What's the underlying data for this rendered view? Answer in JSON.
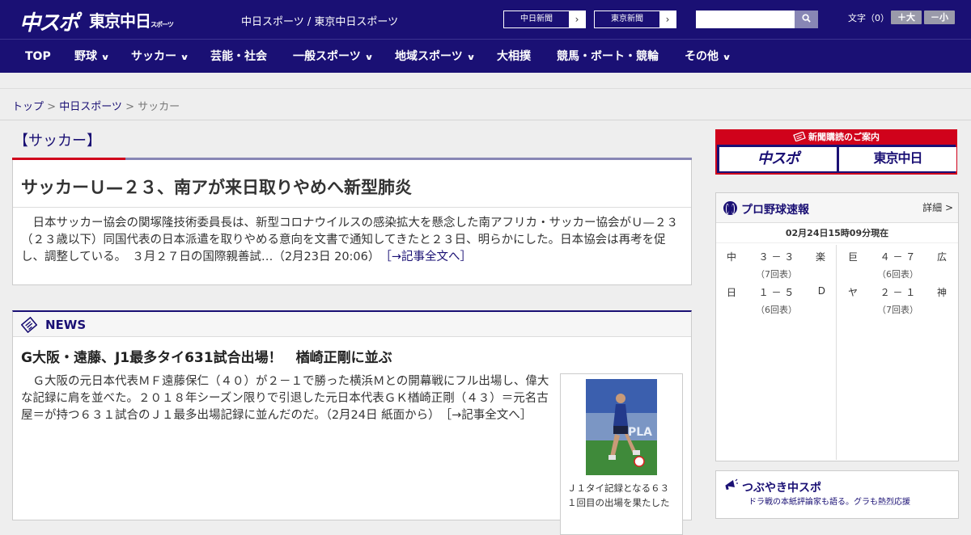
{
  "header": {
    "logo_chunichi": "中スポ",
    "logo_tokyo": "東京中日",
    "logo_tokyo_sub": "スポーツ",
    "site_title": "中日スポーツ / 東京中日スポーツ",
    "paper_links": [
      {
        "label": "中日新聞",
        "arrow": "›"
      },
      {
        "label": "東京新聞",
        "arrow": "›"
      }
    ],
    "search_value": "",
    "search_icon": "search-icon",
    "font_size_label": "文字（0）",
    "font_bigger": "＋大",
    "font_smaller": "－小"
  },
  "nav": [
    {
      "label": "TOP",
      "chevron": false
    },
    {
      "label": "野球",
      "chevron": true
    },
    {
      "label": "サッカー",
      "chevron": true
    },
    {
      "label": "芸能・社会",
      "chevron": false
    },
    {
      "label": "一般スポーツ",
      "chevron": true
    },
    {
      "label": "地域スポーツ",
      "chevron": true
    },
    {
      "label": "大相撲",
      "chevron": false
    },
    {
      "label": "競馬・ボート・競輪",
      "chevron": false
    },
    {
      "label": "その他",
      "chevron": true
    }
  ],
  "breadcrumb": {
    "top": "トップ",
    "sep": " > ",
    "section": "中日スポーツ",
    "current": "サッカー"
  },
  "category_title": "【サッカー】",
  "lead": {
    "headline": "サッカーＵ—２３、南アが来日取りやめへ新型肺炎",
    "body": "　日本サッカー協会の関塚隆技術委員長は、新型コロナウイルスの感染拡大を懸念した南アフリカ・サッカー協会がＵ—２３（２３歳以下）同国代表の日本派遣を取りやめる意向を文書で通知してきたと２３日、明らかにした。日本協会は再考を促し、調整している。　３月２７日の国際親善試…（2月23日 20:06）",
    "more": "［→記事全文へ］"
  },
  "news": {
    "label": "NEWS",
    "icon": "newspaper-icon",
    "headline": "G大阪・遠藤、J1最多タイ631試合出場！　楢崎正剛に並ぶ",
    "body": "　Ｇ大阪の元日本代表ＭＦ遠藤保仁（４０）が２－１で勝った横浜Ｍとの開幕戦にフル出場し、偉大な記録に肩を並べた。２０１８年シーズン限りで引退した元日本代表ＧＫ楢崎正剛（４３）＝元名古屋＝が持つ６３１試合のＪ１最多出場記録に並んだのだ。（2月24日 紙面から）",
    "more": "［→記事全文へ］",
    "caption": "Ｊ１タイ記録となる６３１回目の出場を果たした"
  },
  "ad": {
    "heading": "新聞購読のご案内",
    "logo_a": "中スポ",
    "logo_b": "東京中日"
  },
  "baseball": {
    "title": "プロ野球速報",
    "detail": "詳細 >",
    "time": "02月24日15時09分現在",
    "games": [
      {
        "team1": "中",
        "score": "３ － ３",
        "team2": "楽",
        "inning": "（7回表）"
      },
      {
        "team1": "日",
        "score": "１ － ５",
        "team2": "D",
        "inning": "（6回表）"
      },
      {
        "team1": "巨",
        "score": "４ － ７",
        "team2": "広",
        "inning": "（6回表）"
      },
      {
        "team1": "ヤ",
        "score": "２ － １",
        "team2": "神",
        "inning": "（7回表）"
      }
    ]
  },
  "tweet": {
    "title": "つぶやき中スポ",
    "subtitle": "ドラ戦の本紙評論家も語る。グラも熱烈応援"
  },
  "colors": {
    "brand_navy": "#1a1074",
    "accent_red": "#d0021b",
    "accent_lavender": "#8886b5"
  }
}
